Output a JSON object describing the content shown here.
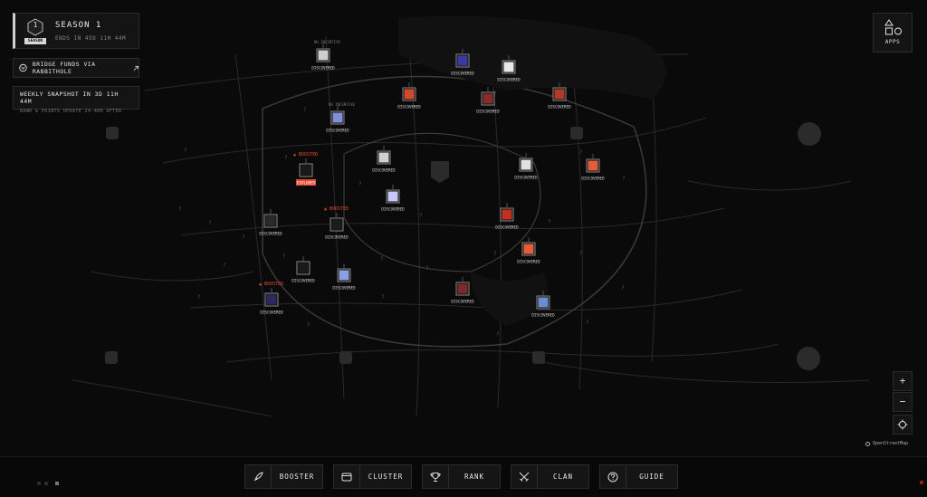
{
  "season": {
    "level": "1",
    "tag": "SEASON",
    "title": "SEASON 1",
    "ends": "ENDS IN 45D 11H 44M"
  },
  "bridge": {
    "label": "BRIDGE FUNDS VIA RABBITHOLE"
  },
  "weekly": {
    "title": "WEEKLY SNAPSHOT IN 3D 11H 44M",
    "subtitle": "RANK & POINTS UPDATE 24-48H AFTER"
  },
  "apps": {
    "label": "APPS"
  },
  "map": {
    "attribution": "OpenStreetMap",
    "zoom_in": "+",
    "zoom_out": "−",
    "status_labels": {
      "discovered": "DISCOVERED",
      "no_incentive": "NO INCENTIVE",
      "boosted": "BOOSTED",
      "explored": "EXPLORED"
    },
    "markers": [
      {
        "status": "discovered",
        "note": "no_incentive",
        "icon_color": "#cfcfcf"
      },
      {
        "status": "discovered",
        "icon_color": "#3a3aa0"
      },
      {
        "status": "discovered",
        "icon_color": "#e8e8e8"
      },
      {
        "status": "discovered",
        "icon_color": "#d24a2e"
      },
      {
        "status": "discovered",
        "icon_color": "#8a2a2a"
      },
      {
        "status": "discovered",
        "icon_color": "#b03a2a"
      },
      {
        "status": "discovered",
        "note": "no_incentive",
        "icon_color": "#7d8fd6"
      },
      {
        "status": "discovered",
        "icon_color": "#d0d0d0"
      },
      {
        "status": "explored",
        "note": "boosted",
        "icon_color": "#1a1a1a"
      },
      {
        "status": "discovered",
        "icon_color": "#e0e0e0"
      },
      {
        "status": "discovered",
        "icon_color": "#e35d3a"
      },
      {
        "status": "discovered",
        "icon_color": "#c8c8ff"
      },
      {
        "status": "discovered",
        "note": "boosted",
        "icon_color": "#1c1c1c"
      },
      {
        "status": "discovered",
        "icon_color": "#2a2a2a"
      },
      {
        "status": "discovered",
        "icon_color": "#c0301e"
      },
      {
        "status": "discovered",
        "icon_color": "#e35d3a"
      },
      {
        "status": "discovered",
        "icon_color": "#1a1a1a"
      },
      {
        "status": "discovered",
        "icon_color": "#8aa0e0"
      },
      {
        "status": "discovered",
        "note": "boosted",
        "icon_color": "#2a2a60"
      },
      {
        "status": "discovered",
        "icon_color": "#7a2a2a"
      },
      {
        "status": "discovered",
        "icon_color": "#6a8fd0"
      }
    ]
  },
  "nav": [
    {
      "label": "BOOSTER",
      "icon": "rocket-icon"
    },
    {
      "label": "CLUSTER",
      "icon": "window-icon"
    },
    {
      "label": "RANK",
      "icon": "trophy-icon"
    },
    {
      "label": "CLAN",
      "icon": "swords-icon"
    },
    {
      "label": "GUIDE",
      "icon": "help-icon"
    }
  ],
  "colors": {
    "background": "#0a0a0a",
    "panel": "#141414",
    "accent": "#e34a32",
    "text": "#e6e6e6"
  }
}
